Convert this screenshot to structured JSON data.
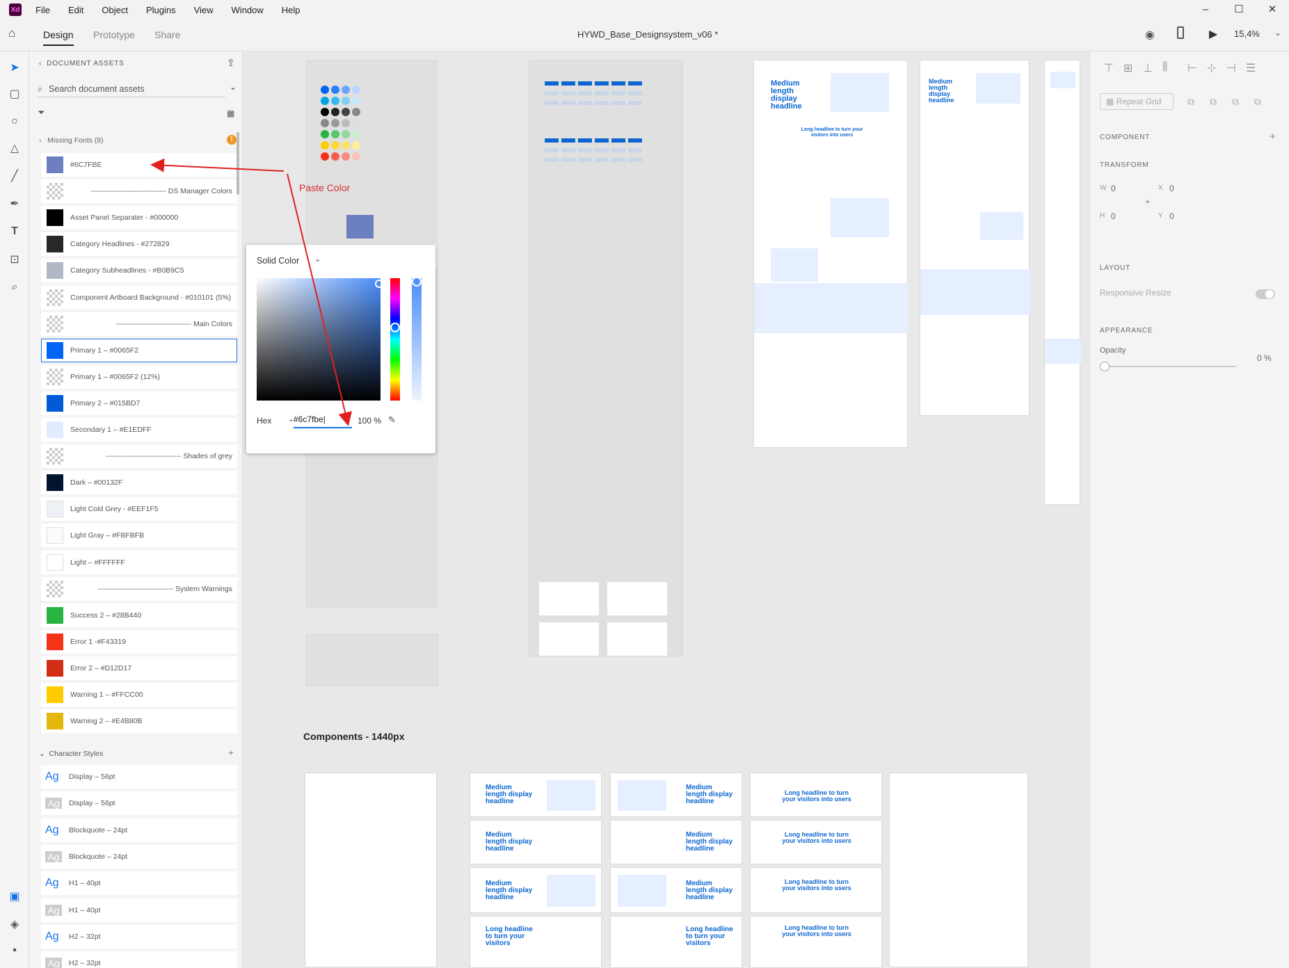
{
  "app": {
    "logo": "Xd",
    "menu": [
      "File",
      "Edit",
      "Object",
      "Plugins",
      "View",
      "Window",
      "Help"
    ],
    "window_controls": [
      "–",
      "☐",
      "✕"
    ]
  },
  "toolbar": {
    "tabs": [
      "Design",
      "Prototype",
      "Share"
    ],
    "doc_title": "HYWD_Base_Designsystem_v06 *",
    "zoom": "15,4%"
  },
  "assets": {
    "header": "DOCUMENT ASSETS",
    "search_placeholder": "Search document assets",
    "missing_fonts": "Missing Fonts (8)",
    "colors": [
      {
        "label": "#6C7FBE",
        "color": "#6c7fbe"
      },
      {
        "label": "------------------------------- DS Manager Colors",
        "color": "checker",
        "right": true
      },
      {
        "label": "Asset Panel Separater - #000000",
        "color": "#000000"
      },
      {
        "label": "Category Headlines - #272829",
        "color": "#272829"
      },
      {
        "label": "Category Subheadlines - #B0B9C5",
        "color": "#b0b9c5"
      },
      {
        "label": "Component Artboard Background - #010101 (5%)",
        "color": "checker"
      },
      {
        "label": "------------------------------- Main Colors",
        "color": "checker",
        "right": true
      },
      {
        "label": "Primary 1 – #0065F2",
        "color": "#0065f2",
        "selected": true
      },
      {
        "label": "Primary 1 – #0065F2 (12%)",
        "color": "checker"
      },
      {
        "label": "Primary 2 – #015BD7",
        "color": "#015bd7"
      },
      {
        "label": "Secondary 1 – #E1EDFF",
        "color": "#e1edff"
      },
      {
        "label": "------------------------------- Shades of grey",
        "color": "checker",
        "right": true
      },
      {
        "label": "Dark – #00132F",
        "color": "#00132f"
      },
      {
        "label": "Light Cold Grey - #EEF1F5",
        "color": "#eef1f5"
      },
      {
        "label": "Light Gray – #FBFBFB",
        "color": "#fbfbfb"
      },
      {
        "label": "Light – #FFFFFF",
        "color": "#ffffff"
      },
      {
        "label": "------------------------------- System Warnings",
        "color": "checker",
        "right": true
      },
      {
        "label": "Success 2 – #28B440",
        "color": "#28b440"
      },
      {
        "label": "Error 1 -#F43319",
        "color": "#f43319"
      },
      {
        "label": "Error 2 – #D12D17",
        "color": "#d12d17"
      },
      {
        "label": "Warning 1 – #FFCC00",
        "color": "#ffcc00"
      },
      {
        "label": "Warning 2 – #E4B80B",
        "color": "#e4b80b"
      }
    ],
    "char_styles_header": "Character Styles",
    "char_styles": [
      {
        "label": "Display – 56pt",
        "dim": false
      },
      {
        "label": "Display – 56pt",
        "dim": true
      },
      {
        "label": "Blockquote – 24pt",
        "dim": false
      },
      {
        "label": "Blockquote – 24pt",
        "dim": true
      },
      {
        "label": "H1 – 40pt",
        "dim": false
      },
      {
        "label": "H1 – 40pt",
        "dim": true
      },
      {
        "label": "H2 – 32pt",
        "dim": false
      },
      {
        "label": "H2 – 32pt",
        "dim": true
      }
    ]
  },
  "picker": {
    "mode": "Solid Color",
    "format": "Hex",
    "value": "#6c7fbe",
    "opacity": "100 %"
  },
  "annotation": {
    "text": "Paste Color"
  },
  "canvas": {
    "section_title": "Components - 1440px",
    "headlines": {
      "medium": "Medium length display headline",
      "long": "Long headline to turn your visitors into users",
      "long_short": "Long headline to turn your visitors"
    }
  },
  "properties": {
    "repeat_grid": "Repeat Grid",
    "component": "COMPONENT",
    "transform": "TRANSFORM",
    "w_label": "W",
    "w": "0",
    "x_label": "X",
    "x": "0",
    "h_label": "H",
    "h": "0",
    "y_label": "Y",
    "y": "0",
    "layout": "LAYOUT",
    "responsive": "Responsive Resize",
    "appearance": "APPEARANCE",
    "opacity_label": "Opacity",
    "opacity": "0 %"
  },
  "colors": {
    "accent": "#1473e6",
    "arrow": "#e02020"
  }
}
